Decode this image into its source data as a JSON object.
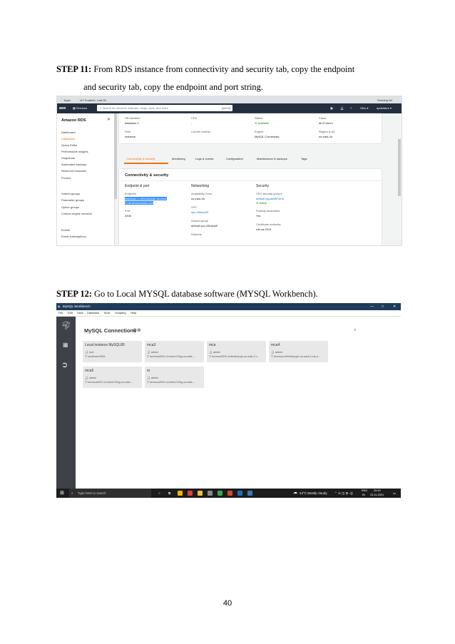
{
  "doc": {
    "step11": {
      "label": "STEP 11:",
      "line1": " From RDS instance from connectivity and security tab, copy the endpoint",
      "line2": "and security tab, copy the endpoint and port string."
    },
    "step12": {
      "label": "STEP 12:",
      "text": " Go to Local MYSQL database software (MYSQL Workbench)."
    },
    "page_number": "40"
  },
  "aws": {
    "tabs": [
      "Apps",
      "IoT Enabled, Leaf W..."
    ],
    "bookmark_right": "Reading list",
    "logo": "aws",
    "services": "Services",
    "search_placeholder": "Search for services, features, blogs, docs, and more",
    "search_shortcut": "[Alt+S]",
    "region": "Ohio ▾",
    "user": "apdelahre ▾",
    "sidebar": {
      "title": "Amazon RDS",
      "close": "✕",
      "items_top": [
        "Dashboard",
        "Databases",
        "Query Editor",
        "Performance insights",
        "Snapshots",
        "Automated backups",
        "Reserved instances",
        "Proxies"
      ],
      "active": "Databases",
      "items_mid": [
        "Subnet groups",
        "Parameter groups",
        "Option groups",
        "Custom engine versions"
      ],
      "items_bot": [
        "Events",
        "Event subscriptions"
      ]
    },
    "summary": {
      "db_identifier_label": "DB identifier",
      "db_identifier": "database-1",
      "cpu_label": "CPU",
      "cpu": "-",
      "status_label": "Status",
      "status": "Available",
      "class_label": "Class",
      "class": "db.t2.micro",
      "role_label": "Role",
      "role": "Instance",
      "activity_label": "Current activity",
      "activity": "",
      "engine_label": "Engine",
      "engine": "MySQL Community",
      "region_label": "Region & AZ",
      "region": "us-east-2a"
    },
    "content_tabs": [
      "Connectivity & security",
      "Monitoring",
      "Logs & events",
      "Configuration",
      "Maintenance & backups",
      "Tags"
    ],
    "section_title": "Connectivity & security",
    "endpoint_port": {
      "heading": "Endpoint & port",
      "endpoint_label": "Endpoint",
      "endpoint_line1": "database-1.chfxekbryojn.us-east-",
      "endpoint_line2": "2.rds.amazonaws.com",
      "port_label": "Port",
      "port": "3306"
    },
    "networking": {
      "heading": "Networking",
      "az_label": "Availability Zone",
      "az": "us-east-2a",
      "vpc_label": "VPC",
      "vpc": "vpc-44baca2f",
      "subnet_group_label": "Subnet group",
      "subnet_group": "default-vpc-44baca2f",
      "subnets_label": "Subnets"
    },
    "security": {
      "heading": "Security",
      "sg_label": "VPC security groups",
      "sg": "default (sg-ae8974e3)",
      "sg_status": "Active",
      "public_label": "Publicly accessible",
      "public": "Yes",
      "ca_label": "Certificate authority",
      "ca": "rds-ca-2019"
    }
  },
  "workbench": {
    "title": "MySQL Workbench",
    "menu": [
      "File",
      "Edit",
      "View",
      "Database",
      "Tools",
      "Scripting",
      "Help"
    ],
    "connections_title": "MySQL Connections",
    "connection_buttons": "⊕⊗",
    "tiles": [
      {
        "name": "Local instance MySQL80",
        "user": "root",
        "host": "localhost:3306"
      },
      {
        "name": "mca3",
        "user": "admin",
        "host": "kecmca2020.c1vxbce7i2bg.us-east-..."
      },
      {
        "name": "mca",
        "user": "admin",
        "host": "kecmca2020.chfxekbryojn.us-east-2.r..."
      },
      {
        "name": "mca4",
        "user": "admin",
        "host": "kecmca.chfxekbryojn.us-east-2.rds.a..."
      },
      {
        "name": "mca5",
        "user": "admin",
        "host": "kecmca2020.c1vxbce7i2bg.us-east-..."
      },
      {
        "name": "m",
        "user": "admin",
        "host": "kecmca2020.c1vxbce7i2bg.us-east-..."
      }
    ],
    "taskbar": {
      "search": "Type here to search",
      "weather": "24°C  Mostly cloudy",
      "lang": "ENG",
      "region": "IN",
      "time": "20:43",
      "date": "23-11-2021"
    }
  }
}
